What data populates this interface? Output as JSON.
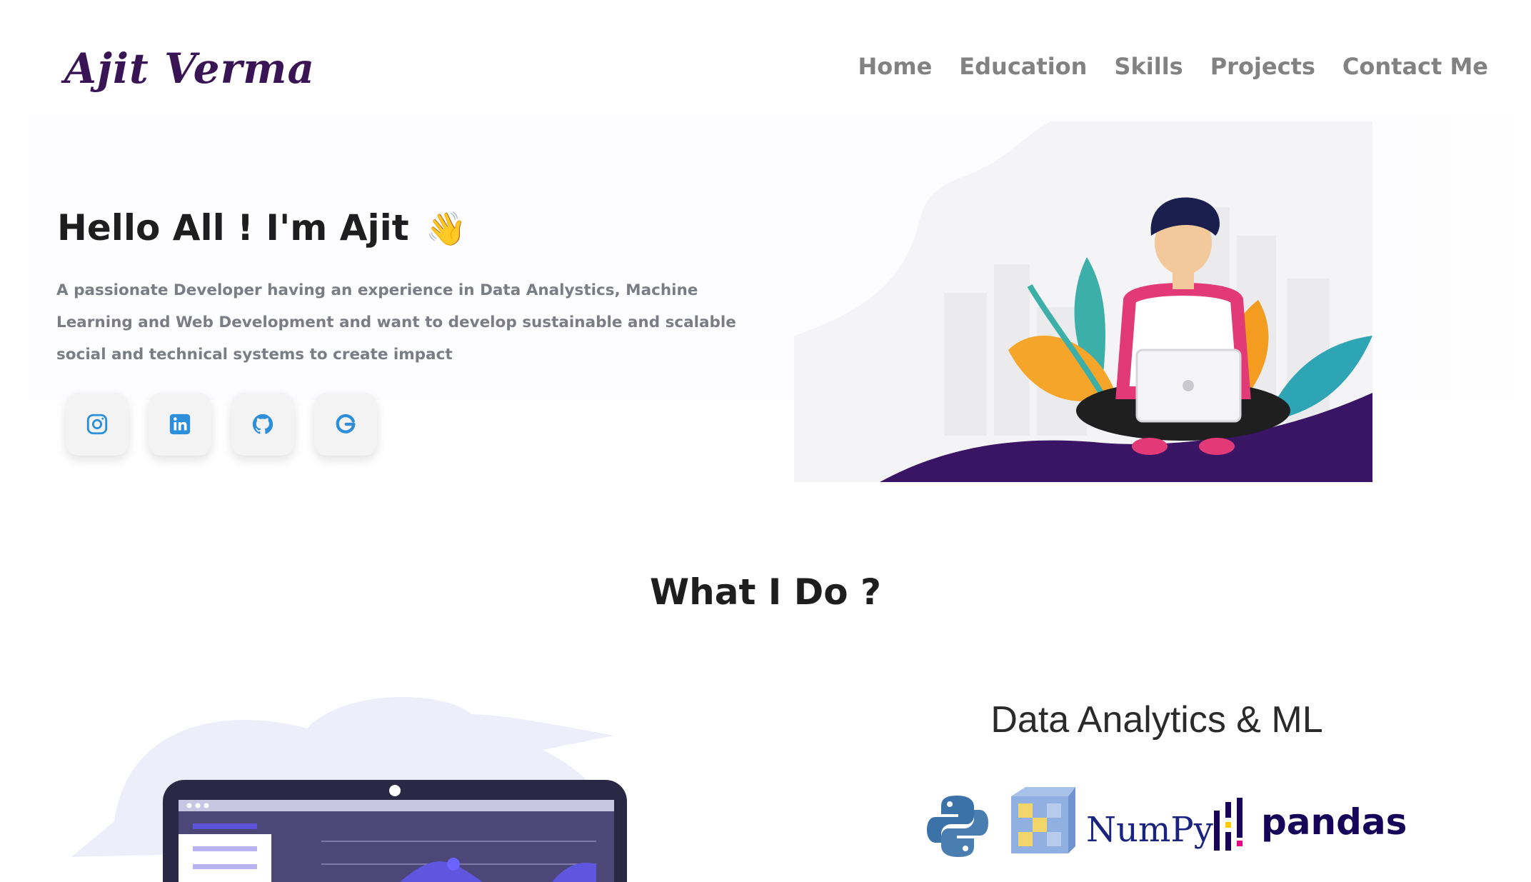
{
  "header": {
    "logo_text": "Ajit Verma",
    "nav": [
      "Home",
      "Education",
      "Skills",
      "Projects",
      "Contact Me"
    ]
  },
  "hero": {
    "title": "Hello All ! I'm Ajit",
    "wave_emoji": "👋",
    "subtitle": "A passionate Developer having an experience in Data Analystics, Machine Learning and Web Development and want to develop sustainable and scalable social and technical systems to create impact",
    "socials": [
      {
        "icon": "instagram-icon"
      },
      {
        "icon": "linkedin-icon"
      },
      {
        "icon": "github-icon"
      },
      {
        "icon": "google-icon"
      }
    ]
  },
  "what_i_do": {
    "title": "What I Do ?",
    "skill_title": "Data Analytics & ML",
    "logos": {
      "numpy": "NumPy",
      "pandas": "pandas"
    }
  },
  "colors": {
    "accent_blue": "#2d8fd9",
    "logo_purple": "#3a1555",
    "nav_gray": "#828282",
    "hill_purple": "#3b1565"
  }
}
